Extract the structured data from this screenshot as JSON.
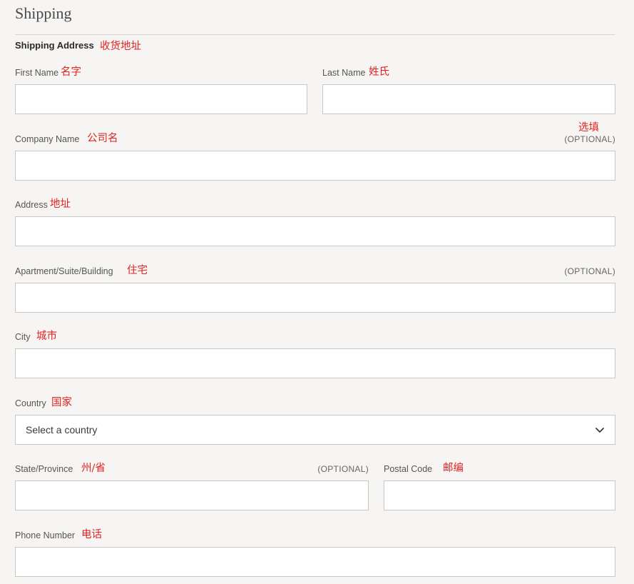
{
  "section": {
    "title": "Shipping",
    "subtitle": "Shipping Address",
    "subtitle_annotation": "收货地址"
  },
  "fields": {
    "first_name": {
      "label": "First Name",
      "annotation": "名字",
      "value": ""
    },
    "last_name": {
      "label": "Last Name",
      "annotation": "姓氏",
      "value": ""
    },
    "company_name": {
      "label": "Company Name",
      "annotation": "公司名",
      "optional_annotation": "选填",
      "optional": "(OPTIONAL)",
      "value": ""
    },
    "address": {
      "label": "Address",
      "annotation": "地址",
      "value": ""
    },
    "apartment": {
      "label": "Apartment/Suite/Building",
      "annotation": "住宅",
      "optional": "(OPTIONAL)",
      "value": ""
    },
    "city": {
      "label": "City",
      "annotation": "城市",
      "value": ""
    },
    "country": {
      "label": "Country",
      "annotation": "国家",
      "selected": "Select a country"
    },
    "state": {
      "label": "State/Province",
      "annotation": "州/省",
      "optional": "(OPTIONAL)",
      "value": ""
    },
    "postal_code": {
      "label": "Postal Code",
      "annotation": "邮编",
      "value": ""
    },
    "phone": {
      "label": "Phone Number",
      "annotation": "电话",
      "value": ""
    }
  },
  "colors": {
    "background": "#f6f5f3",
    "annotation": "#e02424",
    "field_border": "#c9c7c3"
  },
  "icons": {
    "country_dropdown": "chevron-down-icon"
  }
}
